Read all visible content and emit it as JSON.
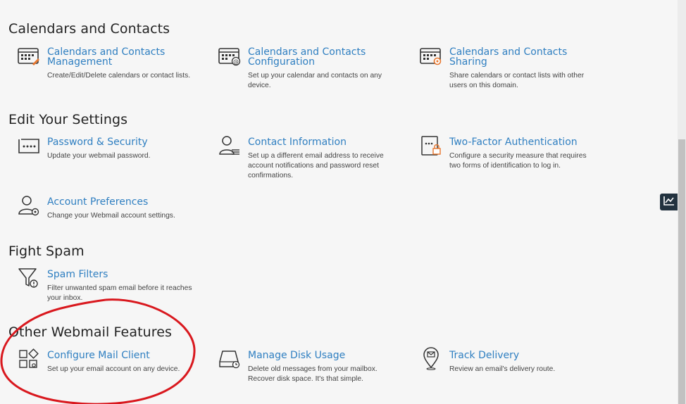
{
  "sections": {
    "calendars": {
      "heading": "Calendars and Contacts",
      "items": [
        {
          "title": "Calendars and Contacts Management",
          "desc": "Create/Edit/Delete calendars or contact lists.",
          "icon": "calendar-edit-icon"
        },
        {
          "title": "Calendars and Contacts Configuration",
          "desc": "Set up your calendar and contacts on any device.",
          "icon": "calendar-at-icon"
        },
        {
          "title": "Calendars and Contacts Sharing",
          "desc": "Share calendars or contact lists with other users on this domain.",
          "icon": "calendar-share-icon"
        }
      ]
    },
    "settings": {
      "heading": "Edit Your Settings",
      "items": [
        {
          "title": "Password & Security",
          "desc": "Update your webmail password.",
          "icon": "password-icon"
        },
        {
          "title": "Contact Information",
          "desc": "Set up a different email address to receive account notifications and password reset confirmations.",
          "icon": "contact-card-icon"
        },
        {
          "title": "Two-Factor Authentication",
          "desc": "Configure a security measure that requires two forms of identification to log in.",
          "icon": "two-factor-lock-icon"
        },
        {
          "title": "Account Preferences",
          "desc": "Change your Webmail account settings.",
          "icon": "user-gear-icon"
        }
      ]
    },
    "spam": {
      "heading": "Fight Spam",
      "items": [
        {
          "title": "Spam Filters",
          "desc": "Filter unwanted spam email before it reaches your inbox.",
          "icon": "filter-icon"
        }
      ]
    },
    "other": {
      "heading": "Other Webmail Features",
      "items": [
        {
          "title": "Configure Mail Client",
          "desc": "Set up your email account on any device.",
          "icon": "mail-client-icon"
        },
        {
          "title": "Manage Disk Usage",
          "desc": "Delete old messages from your mailbox. Recover disk space. It's that simple.",
          "icon": "disk-usage-icon"
        },
        {
          "title": "Track Delivery",
          "desc": "Review an email's delivery route.",
          "icon": "location-pin-icon"
        }
      ]
    }
  },
  "colors": {
    "link": "#2f7fc1",
    "accent_orange": "#e8772e",
    "annotation_circle": "#d9181e"
  }
}
